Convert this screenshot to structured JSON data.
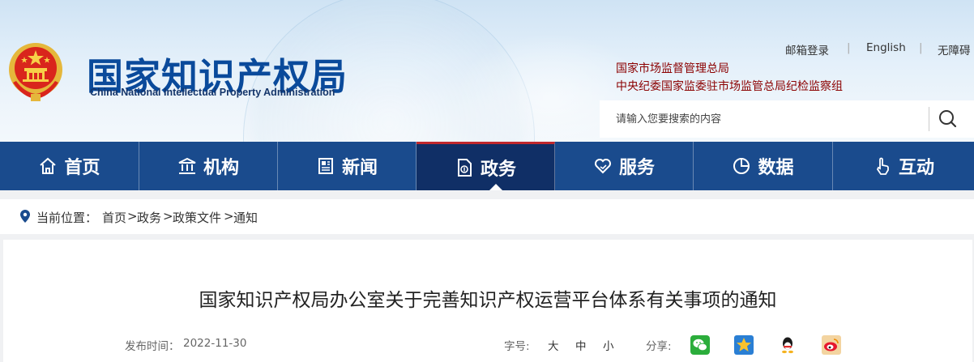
{
  "header": {
    "logo_cn": "国家知识产权局",
    "logo_en": "China National Intellectual Property Administration",
    "top_links": {
      "mail_login": "邮箱登录",
      "english": "English",
      "accessibility": "无障碍",
      "separator": "|"
    },
    "org_links": [
      "国家市场监督管理总局",
      "中央纪委国家监委驻市场监管总局纪检监察组"
    ],
    "search": {
      "placeholder": "请输入您要搜索的内容",
      "value": ""
    }
  },
  "nav": {
    "items": [
      {
        "label": "首页",
        "icon": "home-icon"
      },
      {
        "label": "机构",
        "icon": "institution-icon"
      },
      {
        "label": "新闻",
        "icon": "news-icon"
      },
      {
        "label": "政务",
        "icon": "document-icon",
        "active": true
      },
      {
        "label": "服务",
        "icon": "heart-hand-icon"
      },
      {
        "label": "数据",
        "icon": "pie-chart-icon"
      },
      {
        "label": "互动",
        "icon": "pointer-hand-icon"
      }
    ]
  },
  "breadcrumb": {
    "label": "当前位置：",
    "items": [
      "首页",
      "政务",
      "政策文件",
      "通知"
    ],
    "separator": ">"
  },
  "article": {
    "title": "国家知识产权局办公室关于完善知识产权运营平台体系有关事项的通知",
    "date_label": "发布时间：",
    "date": "2022-11-30",
    "font_size_label": "字号:",
    "font_sizes": [
      "大",
      "中",
      "小"
    ],
    "share_label": "分享:",
    "share_icons": [
      "wechat-icon",
      "qzone-icon",
      "qq-icon",
      "weibo-icon"
    ]
  },
  "colors": {
    "nav_bg": "#1a4b8d",
    "nav_active_bg": "#102f66",
    "logo_blue": "#0a4a9b",
    "org_red": "#8b0000"
  }
}
